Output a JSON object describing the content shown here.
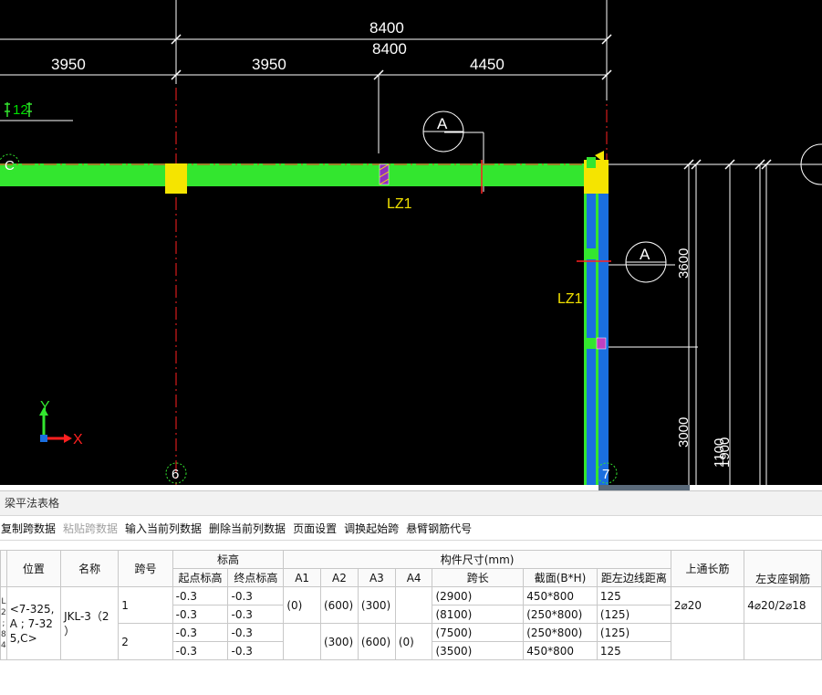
{
  "drawing": {
    "dimensions": {
      "top_total": "8400",
      "total": "8400",
      "span1": "3950",
      "span2": "3950",
      "span3": "4450",
      "right_dim_a": "3600",
      "right_dim_b": "3000",
      "right_dim_c": "1100",
      "right_dim_d": "1900"
    },
    "rebar_note": "12",
    "axis_c": "C",
    "axis_6": "6",
    "axis_7": "7",
    "section_a1": "A",
    "section_a2": "A",
    "column_label_1": "LZ1",
    "column_label_2": "LZ1",
    "ucs_y": "Y",
    "ucs_x": "X",
    "colors": {
      "background": "#000000",
      "beam_green": "#33e62f",
      "column_yellow": "#f5e400",
      "beam_blue": "#1a6fe0",
      "axis_red": "#ff2020"
    }
  },
  "panel": {
    "title": "梁平法表格",
    "toolbar": [
      {
        "label": "复制跨数据",
        "enabled": true
      },
      {
        "label": "粘贴跨数据",
        "enabled": false
      },
      {
        "label": "输入当前列数据",
        "enabled": true
      },
      {
        "label": "删除当前列数据",
        "enabled": true
      },
      {
        "label": "页面设置",
        "enabled": true
      },
      {
        "label": "调换起始跨",
        "enabled": true
      },
      {
        "label": "悬臂钢筋代号",
        "enabled": true
      }
    ],
    "table": {
      "headers": {
        "position": "位置",
        "name": "名称",
        "span_no": "跨号",
        "elevation": "标高",
        "start_elev": "起点标高",
        "end_elev": "终点标高",
        "member_size": "构件尺寸(mm)",
        "a1": "A1",
        "a2": "A2",
        "a3": "A3",
        "a4": "A4",
        "span_len": "跨长",
        "section": "截面(B*H)",
        "edge_dist": "距左边线距离",
        "top_long": "上通长筋",
        "left_seat": "左支座钢筋"
      },
      "row_markers": [
        "L",
        "2",
        ";",
        "8",
        "4"
      ],
      "position_value": "<7-325,A ; 7-325,C>",
      "name_value": "JKL-3（2 ）",
      "top_long_value": "2⌀20",
      "left_seat_value": "4⌀20/2⌀18",
      "rows": [
        {
          "span": "1",
          "start": "-0.3",
          "end": "-0.3",
          "a1": "(0)",
          "a2": "(600)",
          "a3": "(300)",
          "a4": "",
          "len": "(2900)",
          "section": "450*800",
          "dist": "125"
        },
        {
          "span": "",
          "start": "-0.3",
          "end": "-0.3",
          "a1": "",
          "a2": "",
          "a3": "",
          "a4": "",
          "len": "(8100)",
          "section": "(250*800)",
          "dist": "(125)"
        },
        {
          "span": "2",
          "start": "-0.3",
          "end": "-0.3",
          "a1": "",
          "a2": "(300)",
          "a3": "(600)",
          "a4": "(0)",
          "len": "(7500)",
          "section": "(250*800)",
          "dist": "(125)"
        },
        {
          "span": "",
          "start": "-0.3",
          "end": "-0.3",
          "a1": "",
          "a2": "",
          "a3": "",
          "a4": "",
          "len": "(3500)",
          "section": "450*800",
          "dist": "125"
        }
      ]
    }
  }
}
